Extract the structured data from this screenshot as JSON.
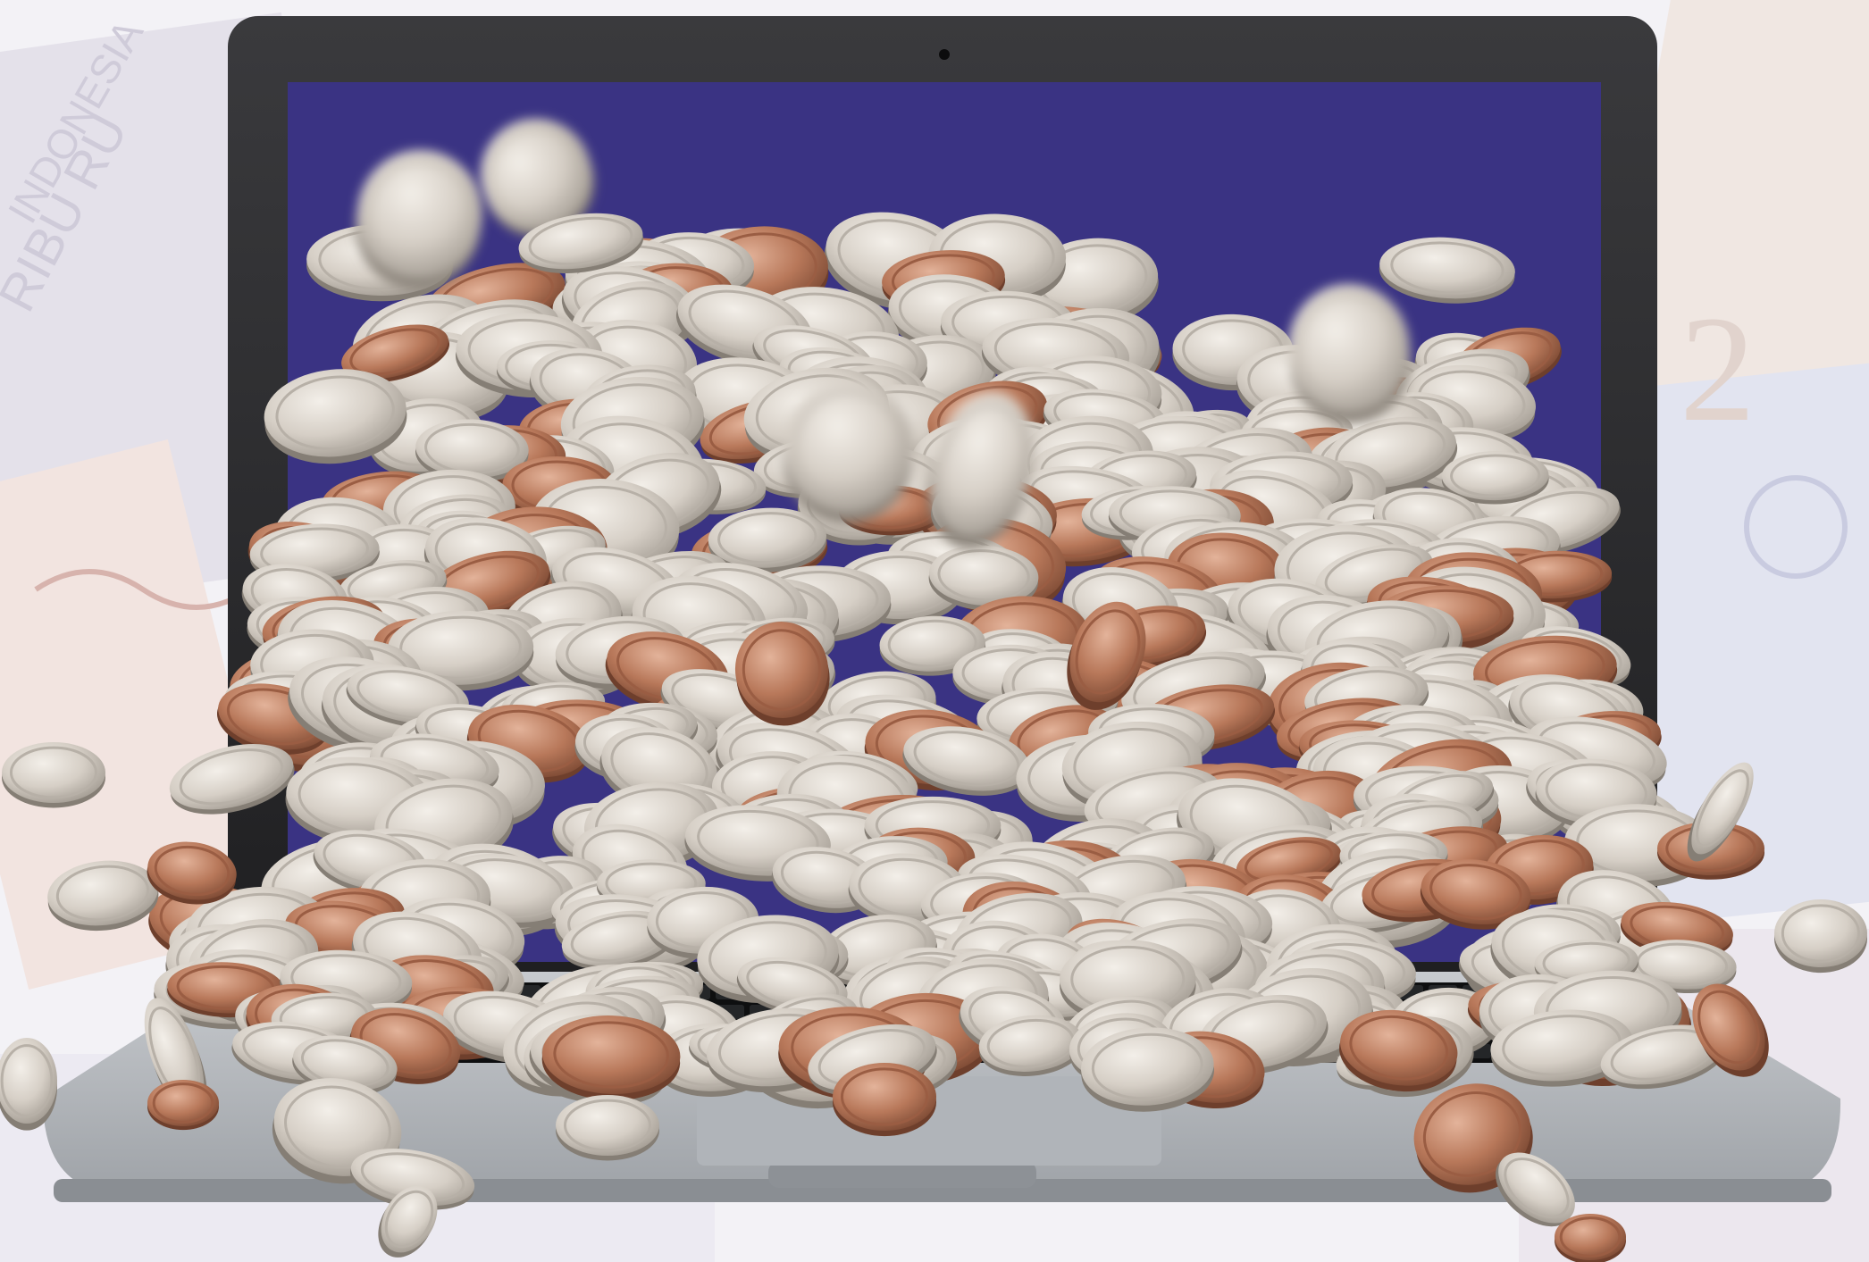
{
  "scene": {
    "subject": "laptop-with-coins",
    "palette": {
      "background": "#f3f2f6",
      "screen": "#3a3383",
      "bezel": "#2b2b2d",
      "deck": "#b9bcc0",
      "keys": "#1b1c1e",
      "silver_coin": "#d6cfc6",
      "silver_coin_shadow": "#9b948b",
      "copper_coin": "#b8785a",
      "copper_coin_shadow": "#7d4a34"
    },
    "banknote_lettering": [
      "INDONESIA",
      "RIBU RU"
    ]
  }
}
